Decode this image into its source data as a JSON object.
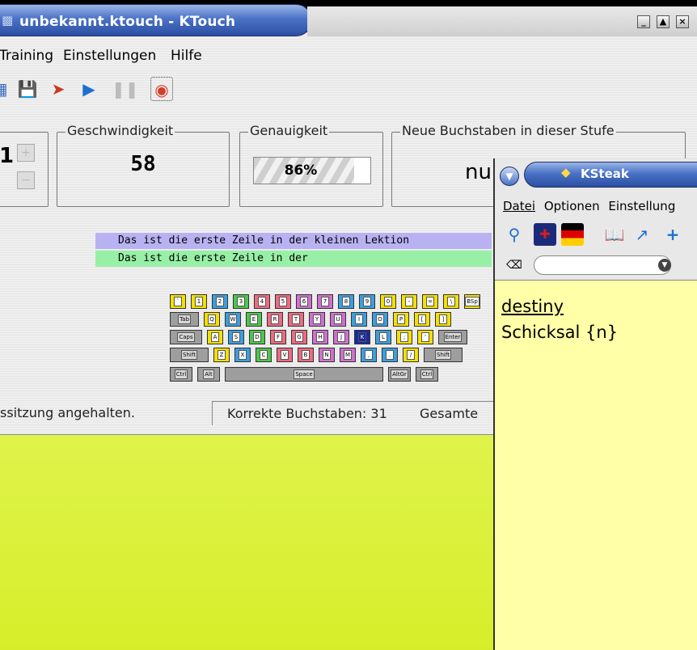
{
  "ktouch": {
    "title": "unbekannt.ktouch - KTouch",
    "window_buttons": [
      "minimize",
      "maximize",
      "close"
    ],
    "menu": [
      "Training",
      "Einstellungen",
      "Hilfe"
    ],
    "toolbar_icons": [
      "open-icon",
      "save-icon",
      "rocket-icon",
      "play-icon",
      "pause-icon",
      "color-icon"
    ],
    "level": {
      "value": "1"
    },
    "speed": {
      "label": "Geschwindigkeit",
      "value": "58"
    },
    "accuracy": {
      "label": "Genauigkeit",
      "value": "86%",
      "percent": 86
    },
    "new_letters": {
      "label": "Neue Buchstaben in dieser Stufe",
      "value": "nu"
    },
    "teacher_line": "Das ist die erste Zeile in der kleinen Lektion",
    "student_line": "Das ist die erste Zeile in der",
    "status_message": "ssitzung angehalten.",
    "status_correct": "Korrekte Buchstaben: 31",
    "status_total": "Gesamte"
  },
  "keyboard": {
    "row1": [
      {
        "k": "`",
        "c": "#f5e000"
      },
      {
        "k": "1",
        "c": "#f5e000"
      },
      {
        "k": "2",
        "c": "#3aa0e0"
      },
      {
        "k": "3",
        "c": "#4ac84a"
      },
      {
        "k": "4",
        "c": "#f06a80"
      },
      {
        "k": "5",
        "c": "#f06a80"
      },
      {
        "k": "6",
        "c": "#d070d0"
      },
      {
        "k": "7",
        "c": "#d070d0"
      },
      {
        "k": "8",
        "c": "#3aa0e0"
      },
      {
        "k": "9",
        "c": "#3aa0e0"
      },
      {
        "k": "0",
        "c": "#f5e000"
      },
      {
        "k": "-",
        "c": "#f5e000"
      },
      {
        "k": "=",
        "c": "#f5e000"
      },
      {
        "k": "\\",
        "c": "#f5e000"
      },
      {
        "k": "BSp",
        "c": "#f5e000"
      }
    ],
    "row2": [
      {
        "k": "Tab",
        "c": "#9e9e9e"
      },
      {
        "k": "Q",
        "c": "#f5e000"
      },
      {
        "k": "W",
        "c": "#3aa0e0"
      },
      {
        "k": "E",
        "c": "#4ac84a"
      },
      {
        "k": "R",
        "c": "#f06a80"
      },
      {
        "k": "T",
        "c": "#f06a80"
      },
      {
        "k": "Y",
        "c": "#d070d0"
      },
      {
        "k": "U",
        "c": "#d070d0"
      },
      {
        "k": "I",
        "c": "#3aa0e0"
      },
      {
        "k": "O",
        "c": "#3aa0e0"
      },
      {
        "k": "P",
        "c": "#f5e000"
      },
      {
        "k": "[",
        "c": "#f5e000"
      },
      {
        "k": "]",
        "c": "#f5e000"
      }
    ],
    "row3": [
      {
        "k": "Caps",
        "c": "#9e9e9e"
      },
      {
        "k": "A",
        "c": "#f5e000"
      },
      {
        "k": "S",
        "c": "#3aa0e0"
      },
      {
        "k": "D",
        "c": "#4ac84a"
      },
      {
        "k": "F",
        "c": "#f06a80"
      },
      {
        "k": "G",
        "c": "#f06a80"
      },
      {
        "k": "H",
        "c": "#d070d0"
      },
      {
        "k": "J",
        "c": "#d070d0"
      },
      {
        "k": "K",
        "c": "#1a2a9a"
      },
      {
        "k": "L",
        "c": "#3aa0e0"
      },
      {
        "k": ";",
        "c": "#f5e000"
      },
      {
        "k": "'",
        "c": "#f5e000"
      },
      {
        "k": "Enter",
        "c": "#9e9e9e"
      }
    ],
    "row4": [
      {
        "k": "Shift",
        "c": "#9e9e9e"
      },
      {
        "k": "Z",
        "c": "#f5e000"
      },
      {
        "k": "X",
        "c": "#3aa0e0"
      },
      {
        "k": "C",
        "c": "#4ac84a"
      },
      {
        "k": "V",
        "c": "#f06a80"
      },
      {
        "k": "B",
        "c": "#f06a80"
      },
      {
        "k": "N",
        "c": "#d070d0"
      },
      {
        "k": "M",
        "c": "#d070d0"
      },
      {
        "k": ",",
        "c": "#3aa0e0"
      },
      {
        "k": ".",
        "c": "#3aa0e0"
      },
      {
        "k": "/",
        "c": "#f5e000"
      },
      {
        "k": "Shift",
        "c": "#9e9e9e"
      }
    ],
    "row5": [
      {
        "k": "Ctrl",
        "c": "#9e9e9e"
      },
      {
        "k": "Alt",
        "c": "#9e9e9e"
      },
      {
        "k": "Space",
        "c": "#9e9e9e"
      },
      {
        "k": "AltGr",
        "c": "#9e9e9e"
      },
      {
        "k": "Ctrl",
        "c": "#9e9e9e"
      }
    ]
  },
  "ksteak": {
    "title": "KSteak",
    "menu": [
      "Datei",
      "Optionen",
      "Einstellung"
    ],
    "toolbar_icons": [
      "search-icon",
      "english-flag-icon",
      "german-flag-icon",
      "book-icon",
      "export-icon",
      "add-icon"
    ],
    "search_value": "",
    "result_word": "destiny",
    "result_translation": "Schicksal {n}"
  },
  "colors": {
    "title_blue": "#3b62b8",
    "desktop_yellow": "#e8f86a",
    "teacher_line": "#b9b2f2",
    "student_line": "#98f0a6",
    "result_bg": "#ffffa8"
  }
}
